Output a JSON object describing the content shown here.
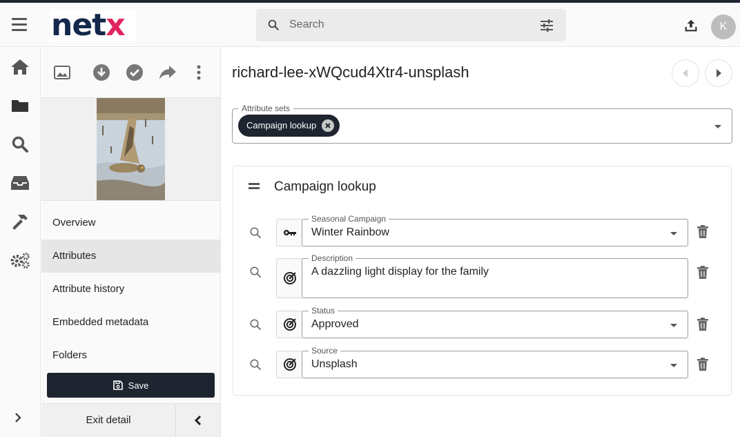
{
  "header": {
    "logo_main": "net",
    "logo_accent": "x",
    "search_placeholder": "Search",
    "avatar_initial": "K"
  },
  "rail": {
    "icons": [
      "home-icon",
      "folder-icon",
      "search-icon",
      "inbox-icon",
      "hammer-icon",
      "settings-icon"
    ]
  },
  "panel": {
    "nav": [
      {
        "label": "Overview",
        "active": false
      },
      {
        "label": "Attributes",
        "active": true
      },
      {
        "label": "Attribute history",
        "active": false
      },
      {
        "label": "Embedded metadata",
        "active": false
      },
      {
        "label": "Folders",
        "active": false
      }
    ],
    "save_label": "Save",
    "exit_label": "Exit detail"
  },
  "main": {
    "title": "richard-lee-xWQcud4Xtr4-unsplash",
    "attribute_sets_label": "Attribute sets",
    "chip_label": "Campaign lookup",
    "card_title": "Campaign lookup",
    "fields": [
      {
        "label": "Seasonal Campaign",
        "value": "Winter Rainbow",
        "type_icon": "key-icon",
        "has_dropdown": true
      },
      {
        "label": "Description",
        "value": "A dazzling light display for the family",
        "type_icon": "radar-icon",
        "has_dropdown": false
      },
      {
        "label": "Status",
        "value": "Approved",
        "type_icon": "radar-icon",
        "has_dropdown": true
      },
      {
        "label": "Source",
        "value": "Unsplash",
        "type_icon": "radar-icon",
        "has_dropdown": true
      }
    ]
  },
  "colors": {
    "dark": "#1e2530",
    "logo_navy": "#14284b",
    "logo_pink": "#e0245e",
    "icon_gray": "#555555"
  }
}
